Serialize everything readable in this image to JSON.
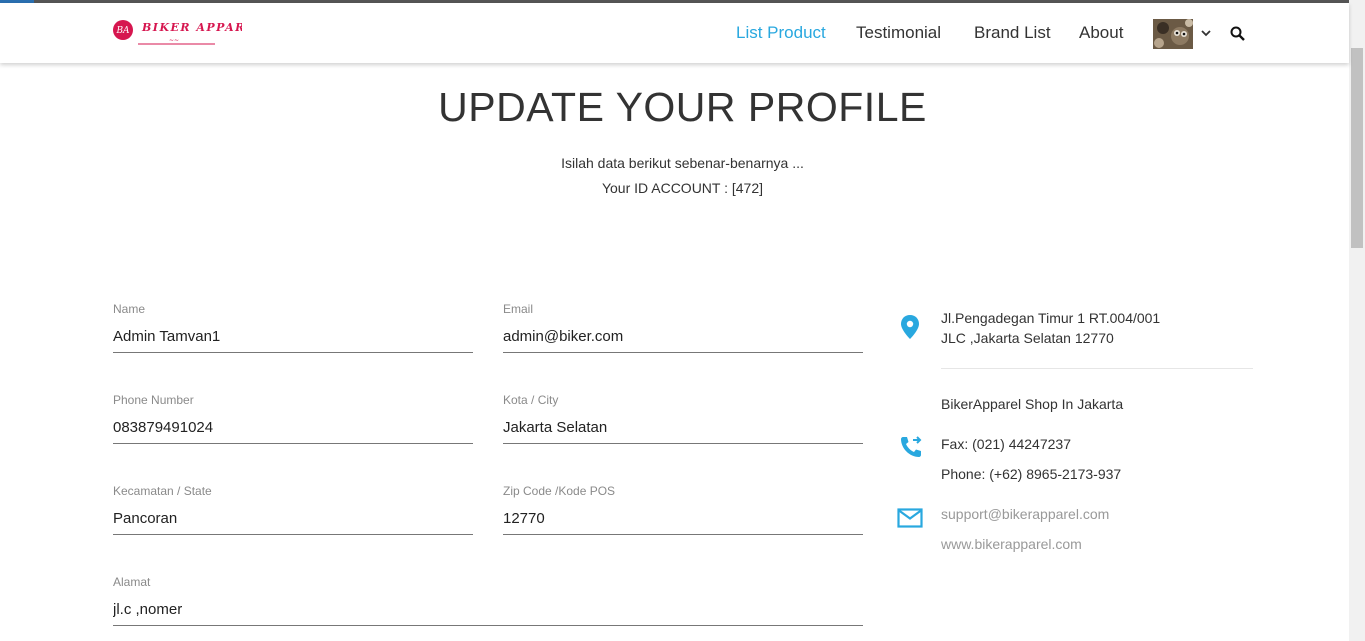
{
  "nav": {
    "logo_text": "BIKER APPAREL",
    "logo_mark": "BA",
    "links": [
      {
        "label": "List Product",
        "active": true
      },
      {
        "label": "Testimonial",
        "active": false
      },
      {
        "label": "Brand List",
        "active": false
      },
      {
        "label": "About",
        "active": false
      }
    ],
    "user_menu_icon": "chevron-down-icon",
    "search_icon": "search-icon"
  },
  "page": {
    "title": "UPDATE YOUR PROFILE",
    "subtitle": "Isilah data berikut sebenar-benarnya ...",
    "account_line": "Your ID ACCOUNT : [472]"
  },
  "form": {
    "name": {
      "label": "Name",
      "value": "Admin Tamvan1"
    },
    "email": {
      "label": "Email",
      "value": "admin@biker.com"
    },
    "phone": {
      "label": "Phone Number",
      "value": "083879491024"
    },
    "city": {
      "label": "Kota / City",
      "value": "Jakarta Selatan"
    },
    "state": {
      "label": "Kecamatan / State",
      "value": "Pancoran"
    },
    "zip": {
      "label": "Zip Code /Kode POS",
      "value": "12770"
    },
    "address": {
      "label": "Alamat",
      "value": "jl.c ,nomer"
    }
  },
  "contact": {
    "address_line1": "Jl.Pengadegan Timur 1 RT.004/001",
    "address_line2": "JLC ,Jakarta Selatan 12770",
    "shop": "BikerApparel Shop In Jakarta",
    "fax": "Fax: (021) 44247237",
    "phone": "Phone: (+62) 8965-2173-937",
    "email": "support@bikerapparel.com",
    "website": "www.bikerapparel.com"
  },
  "colors": {
    "accent": "#29a8df",
    "logo": "#d6164f"
  }
}
